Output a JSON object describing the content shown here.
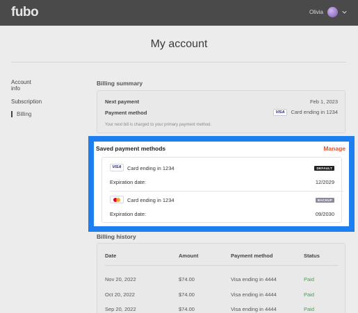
{
  "header": {
    "logo": "fubo",
    "user_name": "Olivia"
  },
  "page": {
    "title": "My account"
  },
  "sidebar": {
    "items": [
      {
        "label": "Account info"
      },
      {
        "label": "Subscription"
      },
      {
        "label": "Billing",
        "active": true
      }
    ]
  },
  "billing_summary": {
    "heading": "Billing summary",
    "next_payment_label": "Next payment",
    "next_payment_value": "Feb 1, 2023",
    "payment_method_label": "Payment method",
    "payment_method_brand": "VISA",
    "payment_method_value": "Card ending in 1234",
    "hint": "Your next bill is charged to your primary payment method."
  },
  "saved_methods": {
    "heading": "Saved payment methods",
    "manage_label": "Manage",
    "cards": [
      {
        "brand": "VISA",
        "icon": "visa-card-icon",
        "label": "Card ending in 1234",
        "tag": "DEFAULT",
        "expiration_label": "Expiration date:",
        "expiration": "12/2029"
      },
      {
        "brand": "mastercard",
        "icon": "mastercard-icon",
        "label": "Card ending in 1234",
        "tag": "BACKUP",
        "expiration_label": "Expiration date:",
        "expiration": "09/2030"
      }
    ]
  },
  "billing_history": {
    "heading": "Billing history",
    "columns": [
      "Date",
      "Amount",
      "Payment method",
      "Status"
    ],
    "rows": [
      [
        "Nov 20, 2022",
        "$74.00",
        "Visa ending in 4444",
        "Paid"
      ],
      [
        "Oct 20, 2022",
        "$74.00",
        "Visa ending in 4444",
        "Paid"
      ],
      [
        "Sep 20, 2022",
        "$74.00",
        "Visa ending in 4444",
        "Paid"
      ]
    ]
  },
  "colors": {
    "header_bg": "#4a4a4a",
    "highlight_border": "#1d7ef0",
    "manage": "#e0522a",
    "paid": "#4d9a5a"
  }
}
